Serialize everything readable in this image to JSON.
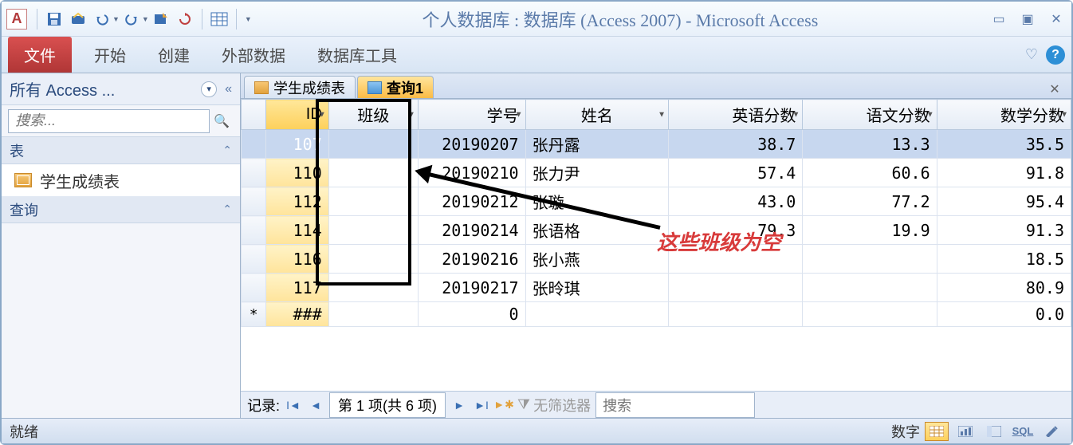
{
  "title": "个人数据库 : 数据库 (Access 2007) - Microsoft Access",
  "app_letter": "A",
  "ribbon": {
    "file": "文件",
    "tabs": [
      "开始",
      "创建",
      "外部数据",
      "数据库工具"
    ]
  },
  "navpane": {
    "header": "所有 Access ...",
    "search_placeholder": "捜索...",
    "groups": [
      {
        "label": "表",
        "items": [
          "学生成绩表"
        ]
      },
      {
        "label": "查询",
        "items": []
      }
    ]
  },
  "tabs": [
    {
      "label": "学生成绩表",
      "type": "table",
      "active": false
    },
    {
      "label": "查询1",
      "type": "query",
      "active": true
    }
  ],
  "columns": [
    "ID",
    "班级",
    "学号",
    "姓名",
    "英语分数",
    "语文分数",
    "数学分数"
  ],
  "rows": [
    {
      "id": "107",
      "class": "",
      "sno": "20190207",
      "name": "张丹露",
      "en": "38.7",
      "cn": "13.3",
      "ma": "35.5",
      "selected": true
    },
    {
      "id": "110",
      "class": "",
      "sno": "20190210",
      "name": "张力尹",
      "en": "57.4",
      "cn": "60.6",
      "ma": "91.8"
    },
    {
      "id": "112",
      "class": "",
      "sno": "20190212",
      "name": "张璇",
      "en": "43.0",
      "cn": "77.2",
      "ma": "95.4"
    },
    {
      "id": "114",
      "class": "",
      "sno": "20190214",
      "name": "张语格",
      "en": "79.3",
      "cn": "19.9",
      "ma": "91.3"
    },
    {
      "id": "116",
      "class": "",
      "sno": "20190216",
      "name": "张小燕",
      "en": "",
      "cn": "",
      "ma": "18.5"
    },
    {
      "id": "117",
      "class": "",
      "sno": "20190217",
      "name": "张昤琪",
      "en": "",
      "cn": "",
      "ma": "80.9"
    }
  ],
  "newrow": {
    "id": "###",
    "sno": "0",
    "ma": "0.0"
  },
  "annotation": "这些班级为空",
  "recnav": {
    "label": "记录:",
    "pos": "第 1 项(共 6 项)",
    "nofilter": "无筛选器",
    "search": "捜索"
  },
  "status": {
    "left": "就绪",
    "right": "数字"
  }
}
